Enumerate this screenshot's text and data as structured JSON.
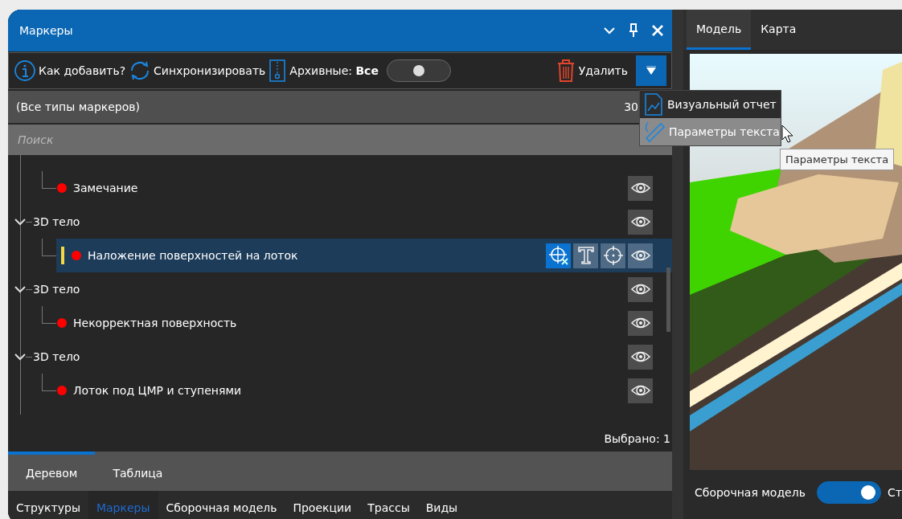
{
  "panel": {
    "title": "Маркеры"
  },
  "toolbar": {
    "help": "Как добавить?",
    "sync": "Синхронизировать",
    "archive_label": "Архивные: **Все**",
    "archive_on": false,
    "delete": "Удалить"
  },
  "filter": {
    "type": "(Все типы маркеров)",
    "count": "30"
  },
  "search": {
    "placeholder": "Поиск"
  },
  "menu": [
    {
      "label": "Визуальный отчет",
      "highlighted": false
    },
    {
      "label": "Параметры текста",
      "highlighted": true
    }
  ],
  "tooltip": "Параметры текста",
  "tree": [
    {
      "children": [
        {
          "label": "Замечание",
          "color": "#ff0000",
          "selected": false
        }
      ]
    },
    {
      "label": "3D тело",
      "expanded": true,
      "children": [
        {
          "label": "Наложение поверхностей на лоток",
          "color": "#ff0000",
          "selected": true
        }
      ]
    },
    {
      "label": "3D тело",
      "expanded": true,
      "children": [
        {
          "label": "Некорректная поверхность",
          "color": "#ff0000",
          "selected": false
        }
      ]
    },
    {
      "label": "3D тело",
      "expanded": true,
      "children": [
        {
          "label": "Лоток под ЦМР и ступенями",
          "color": "#ff0000",
          "selected": false
        }
      ]
    }
  ],
  "status": "Выбрано: 1",
  "view_tabs": [
    {
      "label": "Деревом",
      "selected": true
    },
    {
      "label": "Таблица",
      "selected": false
    }
  ],
  "bottom_tabs": [
    {
      "label": "Структуры",
      "selected": false
    },
    {
      "label": "Маркеры",
      "selected": true
    },
    {
      "label": "Сборочная модель",
      "selected": false
    },
    {
      "label": "Проекции",
      "selected": false
    },
    {
      "label": "Трассы",
      "selected": false
    },
    {
      "label": "Виды",
      "selected": false
    }
  ],
  "viewer": {
    "tabs": [
      {
        "label": "Модель",
        "selected": true
      },
      {
        "label": "Карта",
        "selected": false
      }
    ],
    "assembly_label": "Сборочная модель",
    "assembly_on": true,
    "next_label": "Ст"
  }
}
